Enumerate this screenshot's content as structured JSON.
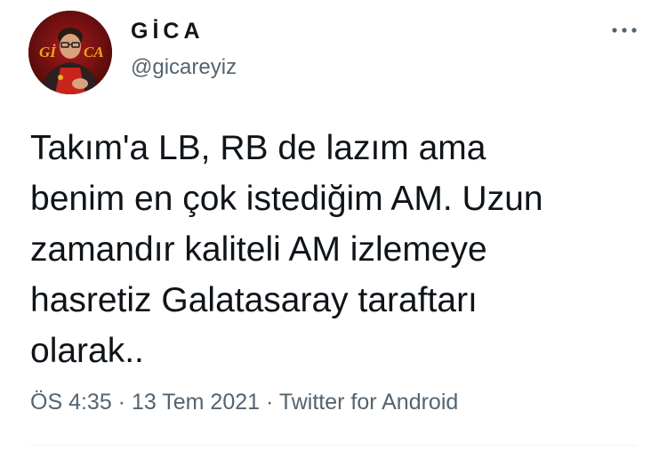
{
  "author": {
    "display_name": "GİCA",
    "handle": "@gicareyiz",
    "avatar_text": "GİCA",
    "avatar_icon": "profile-avatar-icon"
  },
  "menu": {
    "icon": "more-horizontal-icon"
  },
  "tweet": {
    "lines": [
      "Takım'a LB, RB de lazım ama",
      "benim en çok istediğim AM. Uzun",
      "zamandır kaliteli AM izlemeye",
      "hasretiz Galatasaray taraftarı",
      "olarak.."
    ]
  },
  "meta": {
    "time": "ÖS 4:35",
    "separator": " · ",
    "date": "13 Tem 2021",
    "source": "Twitter for Android"
  },
  "colors": {
    "text": "#0f1419",
    "secondary": "#536471",
    "divider": "#eff3f4"
  }
}
